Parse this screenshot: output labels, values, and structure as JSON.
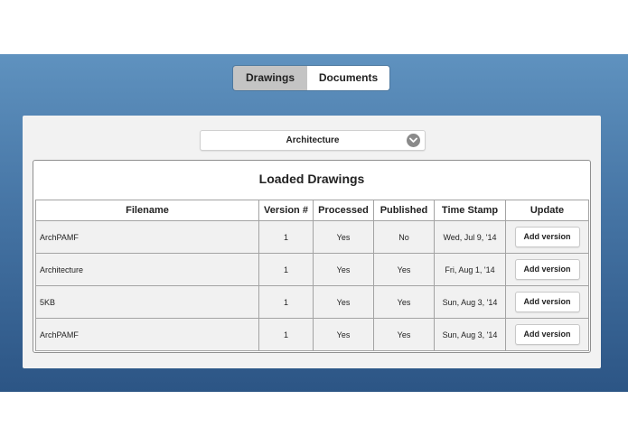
{
  "tabs": [
    {
      "label": "Drawings",
      "active": true
    },
    {
      "label": "Documents",
      "active": false
    }
  ],
  "select": {
    "value": "Architecture",
    "icon": "chevron-down-icon"
  },
  "table": {
    "title": "Loaded Drawings",
    "columns": [
      "Filename",
      "Version #",
      "Processed",
      "Published",
      "Time Stamp",
      "Update"
    ],
    "rows": [
      {
        "filename": "ArchPAMF",
        "version": "1",
        "processed": "Yes",
        "published": "No",
        "timestamp": "Wed, Jul 9, '14",
        "action": "Add version"
      },
      {
        "filename": "Architecture",
        "version": "1",
        "processed": "Yes",
        "published": "Yes",
        "timestamp": "Fri, Aug 1, '14",
        "action": "Add version"
      },
      {
        "filename": "5KB",
        "version": "1",
        "processed": "Yes",
        "published": "Yes",
        "timestamp": "Sun, Aug 3, '14",
        "action": "Add version"
      },
      {
        "filename": "ArchPAMF",
        "version": "1",
        "processed": "Yes",
        "published": "Yes",
        "timestamp": "Sun, Aug 3, '14",
        "action": "Add version"
      }
    ]
  },
  "colors": {
    "band_top": "#5f92bf",
    "band_bottom": "#2c5585",
    "active_tab": "#c4c4c4",
    "panel": "#f2f2f2",
    "row_fill": "#f1f1f1"
  }
}
